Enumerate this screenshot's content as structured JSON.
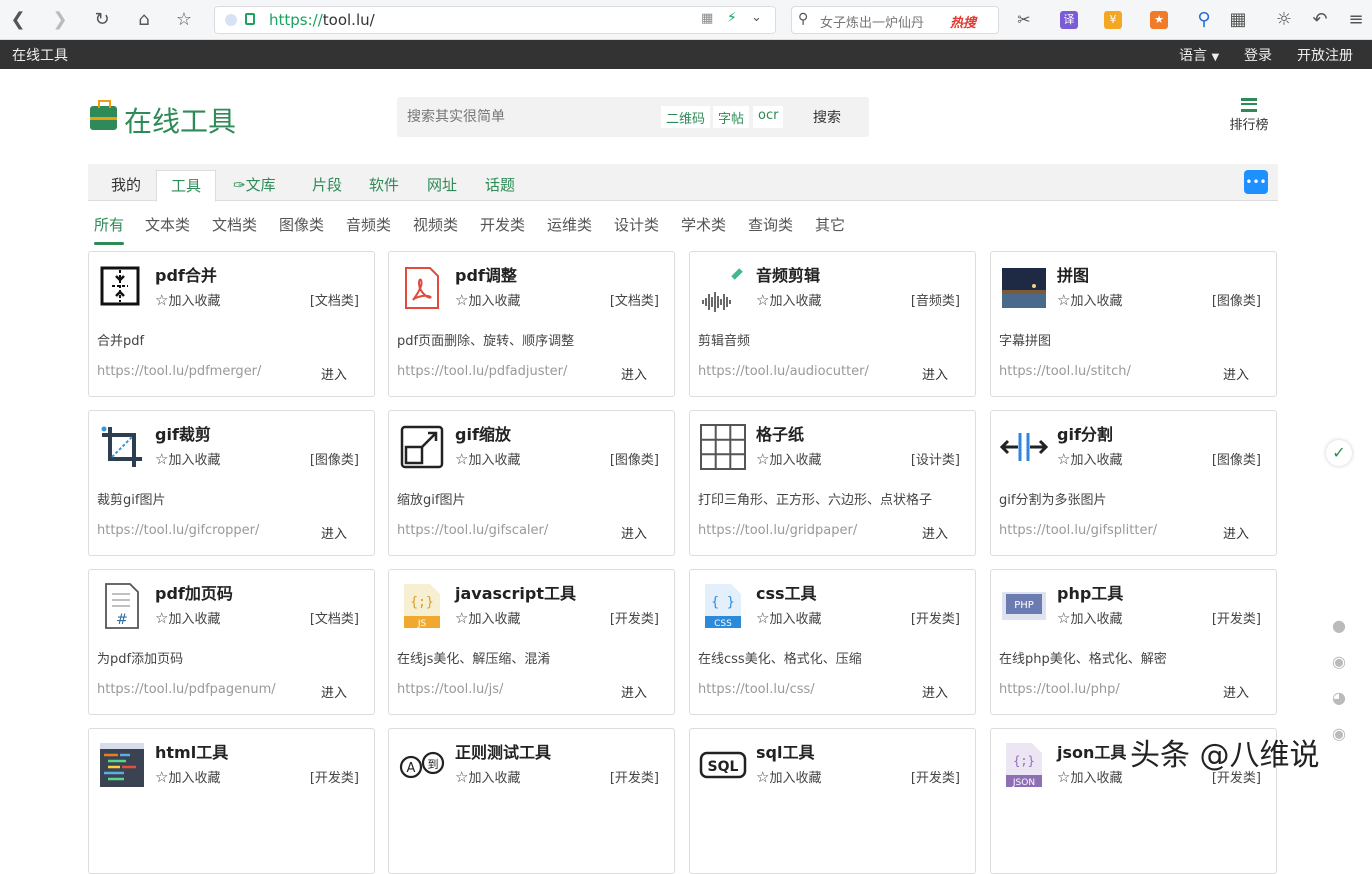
{
  "browser": {
    "url_scheme": "https://",
    "url_host": "tool.lu/",
    "search_placeholder": "女子炼出一炉仙丹",
    "hot_label": "热搜"
  },
  "topbar": {
    "brand": "在线工具",
    "language": "语言",
    "login": "登录",
    "register": "开放注册"
  },
  "header": {
    "logo_text": "在线工具",
    "search_placeholder": "搜索其实很简单",
    "quick_tags": [
      "二维码",
      "字帖",
      "ocr"
    ],
    "search_button": "搜索",
    "rank_label": "排行榜"
  },
  "nav": {
    "tabs": [
      "我的",
      "工具",
      "文库",
      "片段",
      "软件",
      "网址",
      "话题"
    ],
    "active_tab": "工具"
  },
  "categories": {
    "items": [
      "所有",
      "文本类",
      "文档类",
      "图像类",
      "音频类",
      "视频类",
      "开发类",
      "运维类",
      "设计类",
      "学术类",
      "查询类",
      "其它"
    ],
    "active": "所有"
  },
  "card_common": {
    "fav_label": "加入收藏",
    "enter_label": "进入"
  },
  "cards": [
    {
      "name": "pdf合并",
      "category": "[文档类]",
      "desc": "合并pdf",
      "url": "https://tool.lu/pdfmerger/",
      "icon": "pdf-merge-icon"
    },
    {
      "name": "pdf调整",
      "category": "[文档类]",
      "desc": "pdf页面删除、旋转、顺序调整",
      "url": "https://tool.lu/pdfadjuster/",
      "icon": "pdf-file-icon"
    },
    {
      "name": "音频剪辑",
      "category": "[音频类]",
      "desc": "剪辑音频",
      "url": "https://tool.lu/audiocutter/",
      "icon": "audio-wave-icon"
    },
    {
      "name": "拼图",
      "category": "[图像类]",
      "desc": "字幕拼图",
      "url": "https://tool.lu/stitch/",
      "icon": "photo-stitch-icon"
    },
    {
      "name": "gif裁剪",
      "category": "[图像类]",
      "desc": "裁剪gif图片",
      "url": "https://tool.lu/gifcropper/",
      "icon": "crop-icon"
    },
    {
      "name": "gif缩放",
      "category": "[图像类]",
      "desc": "缩放gif图片",
      "url": "https://tool.lu/gifscaler/",
      "icon": "scale-icon"
    },
    {
      "name": "格子纸",
      "category": "[设计类]",
      "desc": "打印三角形、正方形、六边形、点状格子",
      "url": "https://tool.lu/gridpaper/",
      "icon": "grid-icon"
    },
    {
      "name": "gif分割",
      "category": "[图像类]",
      "desc": "gif分割为多张图片",
      "url": "https://tool.lu/gifsplitter/",
      "icon": "split-icon"
    },
    {
      "name": "pdf加页码",
      "category": "[文档类]",
      "desc": "为pdf添加页码",
      "url": "https://tool.lu/pdfpagenum/",
      "icon": "page-number-icon"
    },
    {
      "name": "javascript工具",
      "category": "[开发类]",
      "desc": "在线js美化、解压缩、混淆",
      "url": "https://tool.lu/js/",
      "icon": "js-file-icon"
    },
    {
      "name": "css工具",
      "category": "[开发类]",
      "desc": "在线css美化、格式化、压缩",
      "url": "https://tool.lu/css/",
      "icon": "css-file-icon"
    },
    {
      "name": "php工具",
      "category": "[开发类]",
      "desc": "在线php美化、格式化、解密",
      "url": "https://tool.lu/php/",
      "icon": "php-icon"
    },
    {
      "name": "html工具",
      "category": "[开发类]",
      "desc": "",
      "url": "",
      "icon": "html-code-icon"
    },
    {
      "name": "正则测试工具",
      "category": "[开发类]",
      "desc": "",
      "url": "",
      "icon": "regex-icon"
    },
    {
      "name": "sql工具",
      "category": "[开发类]",
      "desc": "",
      "url": "",
      "icon": "sql-icon"
    },
    {
      "name": "json工具",
      "category": "[开发类]",
      "desc": "",
      "url": "",
      "icon": "json-file-icon"
    }
  ],
  "watermark": "头条 @八维说",
  "colors": {
    "brand_green": "#2e8b57",
    "topbar": "#333333",
    "pdf_red": "#e04b3c",
    "chat_blue": "#1e90ff"
  }
}
